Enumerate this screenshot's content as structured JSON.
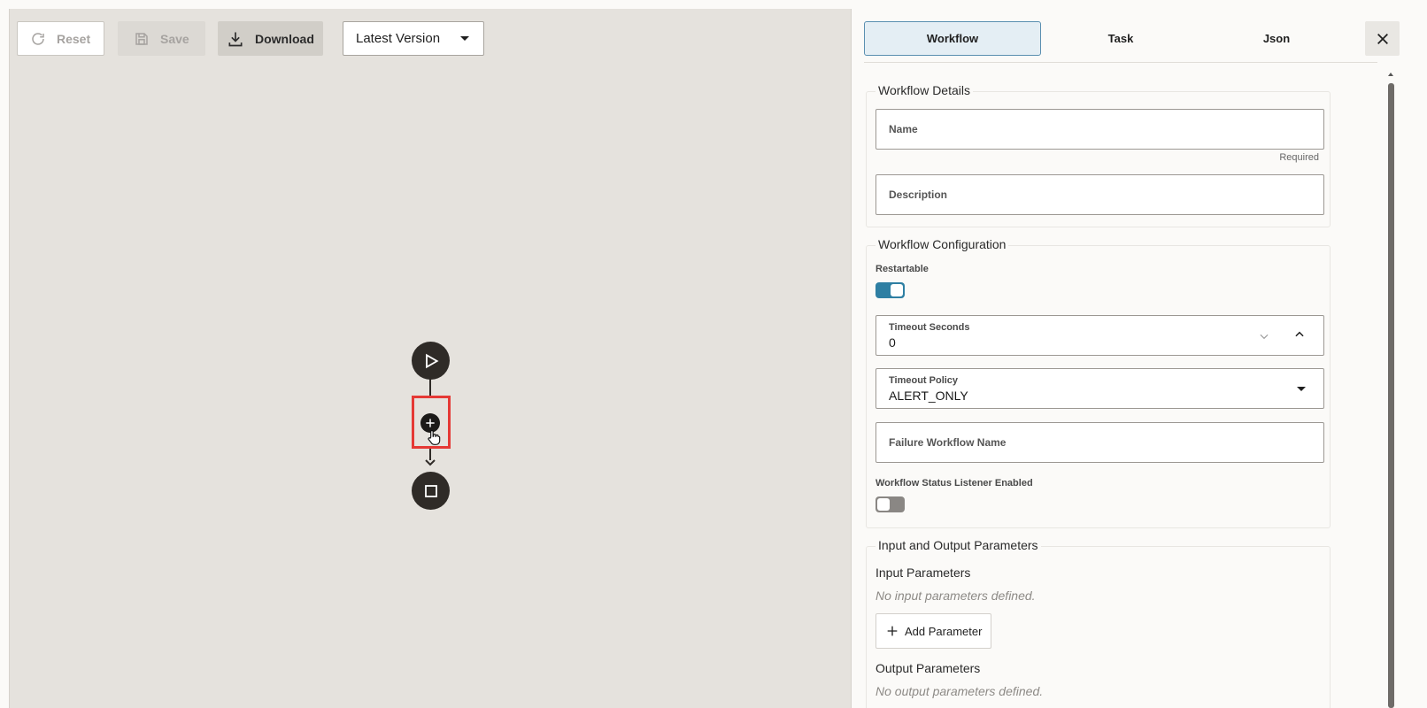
{
  "toolbar": {
    "reset_label": "Reset",
    "save_label": "Save",
    "download_label": "Download",
    "version_selected": "Latest Version"
  },
  "tabs": {
    "workflow": "Workflow",
    "task": "Task",
    "json": "Json",
    "active": "Workflow"
  },
  "details": {
    "title": "Workflow Details",
    "name_placeholder": "Name",
    "name_helper": "Required",
    "description_placeholder": "Description"
  },
  "config": {
    "title": "Workflow Configuration",
    "restartable_label": "Restartable",
    "restartable_on": true,
    "timeout_seconds_label": "Timeout Seconds",
    "timeout_seconds_value": "0",
    "timeout_policy_label": "Timeout Policy",
    "timeout_policy_value": "ALERT_ONLY",
    "failure_workflow_placeholder": "Failure Workflow Name",
    "status_listener_label": "Workflow Status Listener Enabled",
    "status_listener_on": false
  },
  "io": {
    "title": "Input and Output Parameters",
    "input_heading": "Input Parameters",
    "input_empty": "No input parameters defined.",
    "add_parameter_label": "Add Parameter",
    "output_heading": "Output Parameters",
    "output_empty": "No output parameters defined."
  },
  "colors": {
    "accent": "#2e7fa3",
    "canvas_bg": "#e5e2dd",
    "node": "#2f2b27",
    "highlight": "#e53935"
  },
  "icons": {
    "reset": "refresh-icon",
    "save": "floppy-disk-icon",
    "download": "download-icon",
    "close": "close-icon",
    "start": "play-icon",
    "end": "stop-icon",
    "add": "plus-icon"
  }
}
